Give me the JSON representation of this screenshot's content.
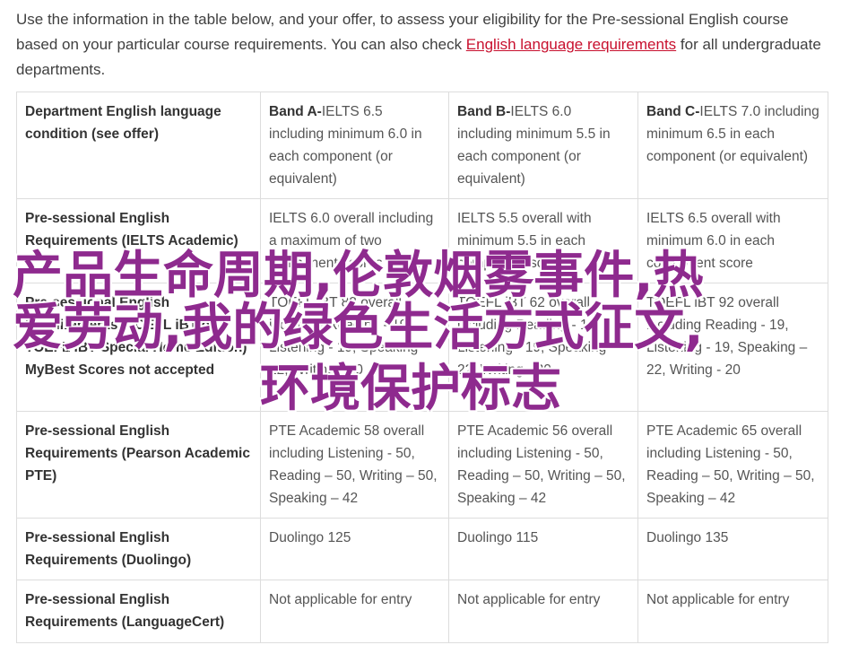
{
  "intro": {
    "text_before": "Use the information in the table below, and your offer, to assess your eligibility for the Pre-sessional English course based on your particular course requirements. You can also check ",
    "link": "English language requirements",
    "text_after": " for all undergraduate departments."
  },
  "table": {
    "header": {
      "condition": "Department English language condition (see offer)",
      "bands": [
        {
          "name": "Band A-",
          "detail": "IELTS 6.5 including minimum 6.0 in each component (or equivalent)"
        },
        {
          "name": "Band B-",
          "detail": "IELTS 6.0 including minimum 5.5 in each component (or equivalent)"
        },
        {
          "name": "Band C-",
          "detail": "IELTS 7.0 including minimum 6.5 in each component (or equivalent)"
        }
      ]
    },
    "rows": [
      {
        "label": "Pre-sessional English Requirements (IELTS Academic)",
        "cells": [
          "IELTS 6.0 overall including a maximum of two component scores at 5.5",
          "IELTS 5.5 overall with minimum 5.5 in each component score",
          "IELTS 6.5 overall with minimum 6.0 in each component score"
        ]
      },
      {
        "label": "Pre-sessional English Requirements (TOEFL iBT or TOEFL iBT Special Home Edition) MyBest Scores not accepted",
        "cells": [
          "TOEFL iBT 82 overall including Reading - 19, Listening - 19, Speaking – 22, Writing - 20",
          "TOEFL iBT 62 overall including Reading - 19, Listening - 19, Speaking – 22, Writing - 20",
          "TOEFL iBT 92 overall including Reading - 19, Listening - 19, Speaking – 22, Writing - 20"
        ]
      },
      {
        "label": "Pre-sessional English Requirements (Pearson Academic PTE)",
        "cells": [
          "PTE Academic 58 overall including Listening - 50, Reading – 50, Writing – 50, Speaking – 42",
          "PTE Academic 56 overall including Listening - 50, Reading – 50, Writing – 50, Speaking – 42",
          "PTE Academic 65 overall including Listening - 50, Reading – 50, Writing – 50, Speaking – 42"
        ]
      },
      {
        "label": "Pre-sessional English Requirements (Duolingo)",
        "cells": [
          "Duolingo 125",
          "Duolingo 115",
          "Duolingo 135"
        ]
      },
      {
        "label": "Pre-sessional English Requirements (LanguageCert)",
        "cells": [
          "Not applicable for entry",
          "Not applicable for entry",
          "Not applicable for entry"
        ]
      }
    ]
  },
  "overlay": {
    "line1": "产品生命周期,伦敦烟雾事件,热",
    "line2": "爱劳动,我的绿色生活方式征文,",
    "line3": "环境保护标志",
    "color": "#8e2a8e"
  }
}
